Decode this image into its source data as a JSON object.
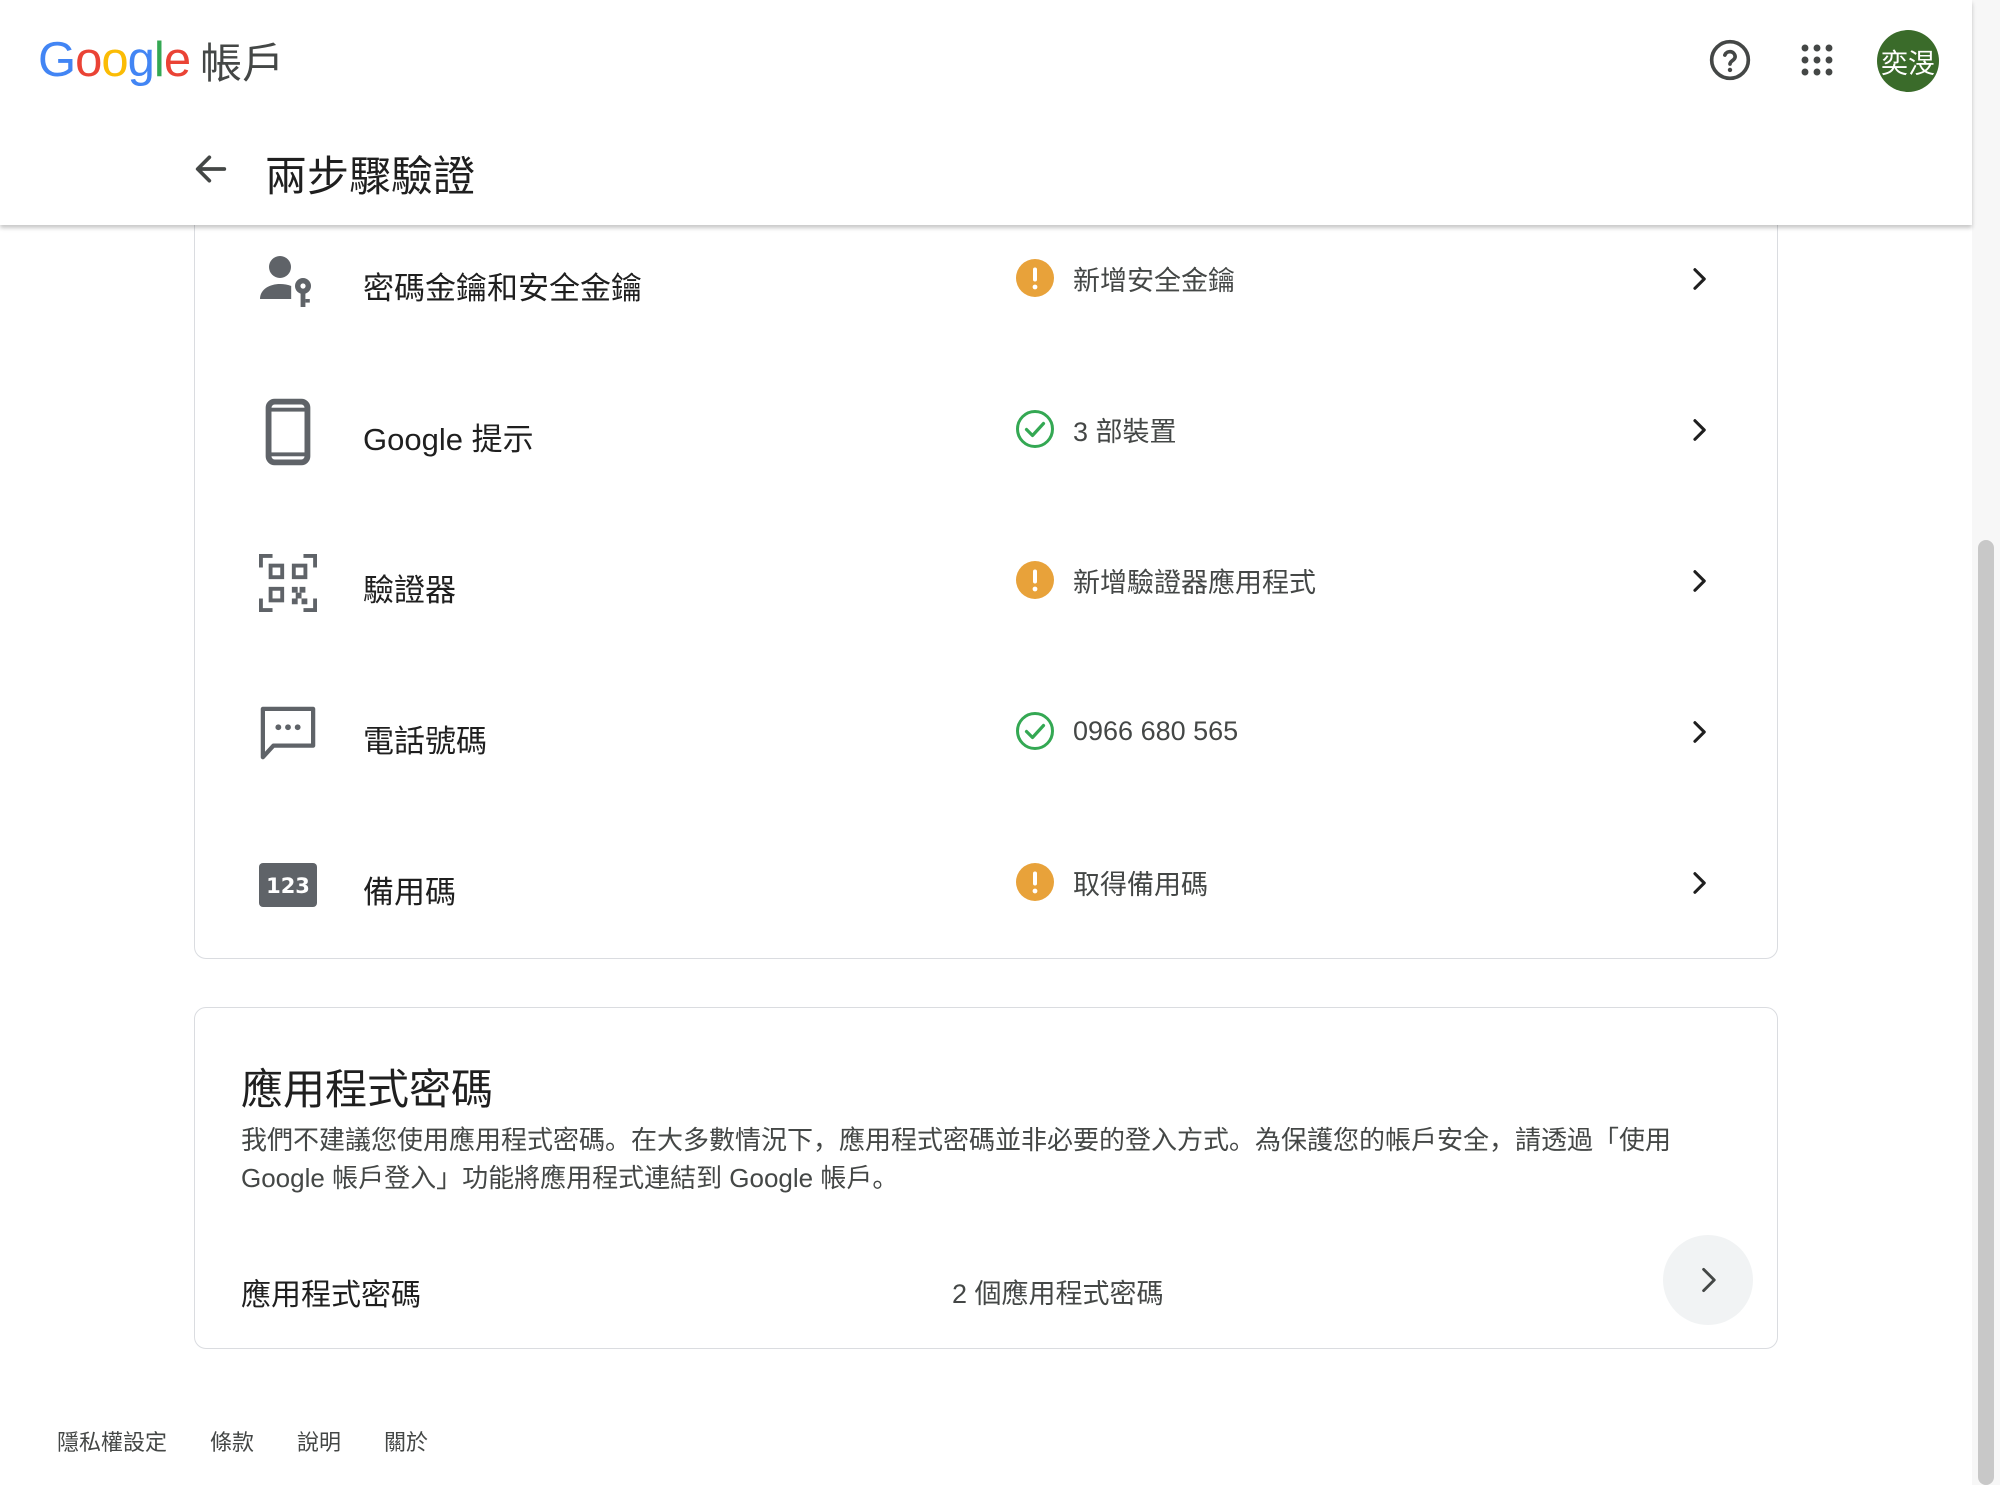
{
  "header": {
    "logo_letters": [
      {
        "ch": "G",
        "color": "#4285F4"
      },
      {
        "ch": "o",
        "color": "#EA4335"
      },
      {
        "ch": "o",
        "color": "#FBBC05"
      },
      {
        "ch": "g",
        "color": "#4285F4"
      },
      {
        "ch": "l",
        "color": "#34A853"
      },
      {
        "ch": "e",
        "color": "#EA4335"
      }
    ],
    "product": "帳戶",
    "help_icon": "help-circle-icon",
    "apps_icon": "apps-grid-icon",
    "avatar_text": "奕渂",
    "avatar_color": "#3a6b2a"
  },
  "page": {
    "title": "兩步驟驗證",
    "back_icon": "arrow-back-icon"
  },
  "methods": [
    {
      "icon": "passkey-icon",
      "label": "密碼金鑰和安全金鑰",
      "status_icon": "warning-icon",
      "status": "新增安全金鑰"
    },
    {
      "icon": "phone-icon",
      "label": "Google 提示",
      "status_icon": "check-circle-icon",
      "status": "3 部裝置"
    },
    {
      "icon": "qr-code-icon",
      "label": "驗證器",
      "status_icon": "warning-icon",
      "status": "新增驗證器應用程式"
    },
    {
      "icon": "sms-icon",
      "label": "電話號碼",
      "status_icon": "check-circle-icon",
      "status": "0966 680 565"
    },
    {
      "icon": "backup-codes-icon",
      "label": "備用碼",
      "status_icon": "warning-icon",
      "status": "取得備用碼"
    }
  ],
  "colors": {
    "warning": "#E8A23A",
    "success": "#34A853",
    "icon_gray": "#5f6368"
  },
  "app_passwords": {
    "title": "應用程式密碼",
    "description": "我們不建議您使用應用程式密碼。在大多數情況下，應用程式密碼並非必要的登入方式。為保護您的帳戶安全，請透過「使用 Google 帳戶登入」功能將應用程式連結到 Google 帳戶。",
    "row_label": "應用程式密碼",
    "row_value": "2 個應用程式密碼"
  },
  "footer": {
    "links": [
      "隱私權設定",
      "條款",
      "說明",
      "關於"
    ]
  }
}
